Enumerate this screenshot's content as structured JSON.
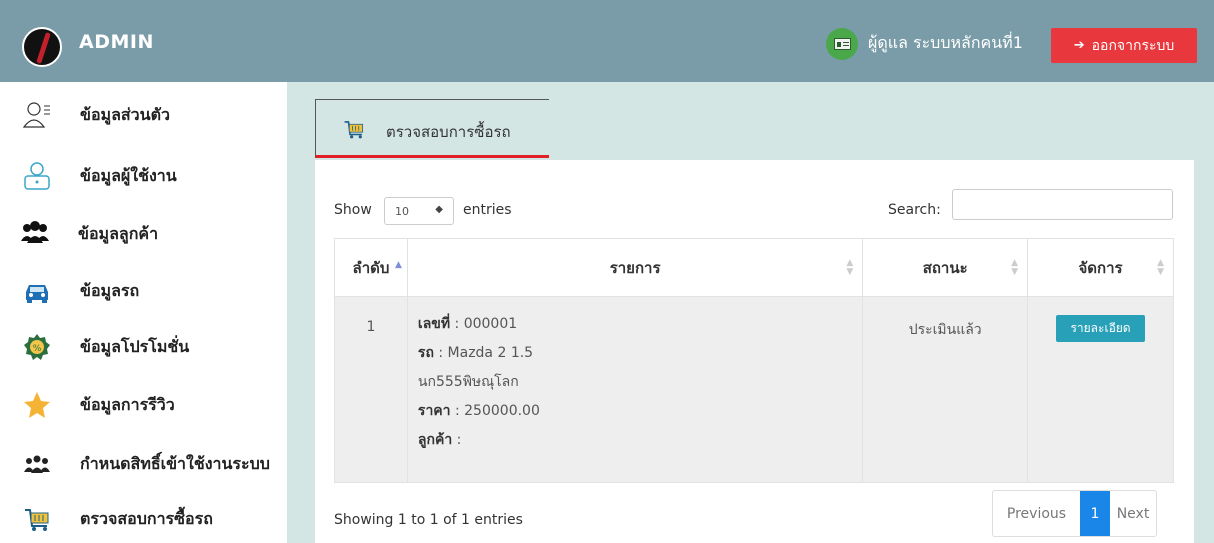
{
  "header": {
    "title": "ADMIN",
    "user_label": "ผู้ดูแล ระบบหลักคนที่1",
    "logout_label": "ออกจากระบบ"
  },
  "sidebar": {
    "items": [
      {
        "label": "ข้อมูลส่วนตัว",
        "icon": "profile-icon"
      },
      {
        "label": "ข้อมูลผู้ใช้งาน",
        "icon": "user-desk-icon"
      },
      {
        "label": "ข้อมูลลูกค้า",
        "icon": "customers-icon"
      },
      {
        "label": "ข้อมูลรถ",
        "icon": "car-icon"
      },
      {
        "label": "ข้อมูลโปรโมชั่น",
        "icon": "promotion-icon"
      },
      {
        "label": "ข้อมูลการรีวิว",
        "icon": "star-icon"
      },
      {
        "label": "กำหนดสิทธิ์เข้าใช้งานระบบ",
        "icon": "group-icon"
      },
      {
        "label": "ตรวจสอบการซื้อรถ",
        "icon": "cart-icon"
      }
    ]
  },
  "tab": {
    "label": "ตรวจสอบการซื้อรถ"
  },
  "table_controls": {
    "show_label": "Show",
    "entries_value": "10",
    "entries_label": "entries",
    "search_label": "Search:",
    "search_value": ""
  },
  "table": {
    "headers": [
      "ลำดับ",
      "รายการ",
      "สถานะ",
      "จัดการ"
    ],
    "rows": [
      {
        "index": "1",
        "no_key": "เลขที่",
        "no_value": ": 000001",
        "car_key": "รถ",
        "car_value": ": Mazda 2 1.5",
        "plate": "นก555พิษณุโลก",
        "price_key": "ราคา",
        "price_value": ": 250000.00",
        "customer_key": "ลูกค้า",
        "customer_value": ":",
        "status": "ประเมินแล้ว",
        "action_label": "รายละเอียด"
      }
    ]
  },
  "footer": {
    "showing": "Showing 1 to 1 of 1 entries",
    "prev": "Previous",
    "page": "1",
    "next": "Next"
  },
  "colors": {
    "header_bg": "#7a9ba8",
    "logout": "#e8383d",
    "content_bg": "#d4e6e4",
    "tab_underline": "#e01f26",
    "detail_button": "#27a0b8",
    "active_page": "#1a86e8"
  }
}
